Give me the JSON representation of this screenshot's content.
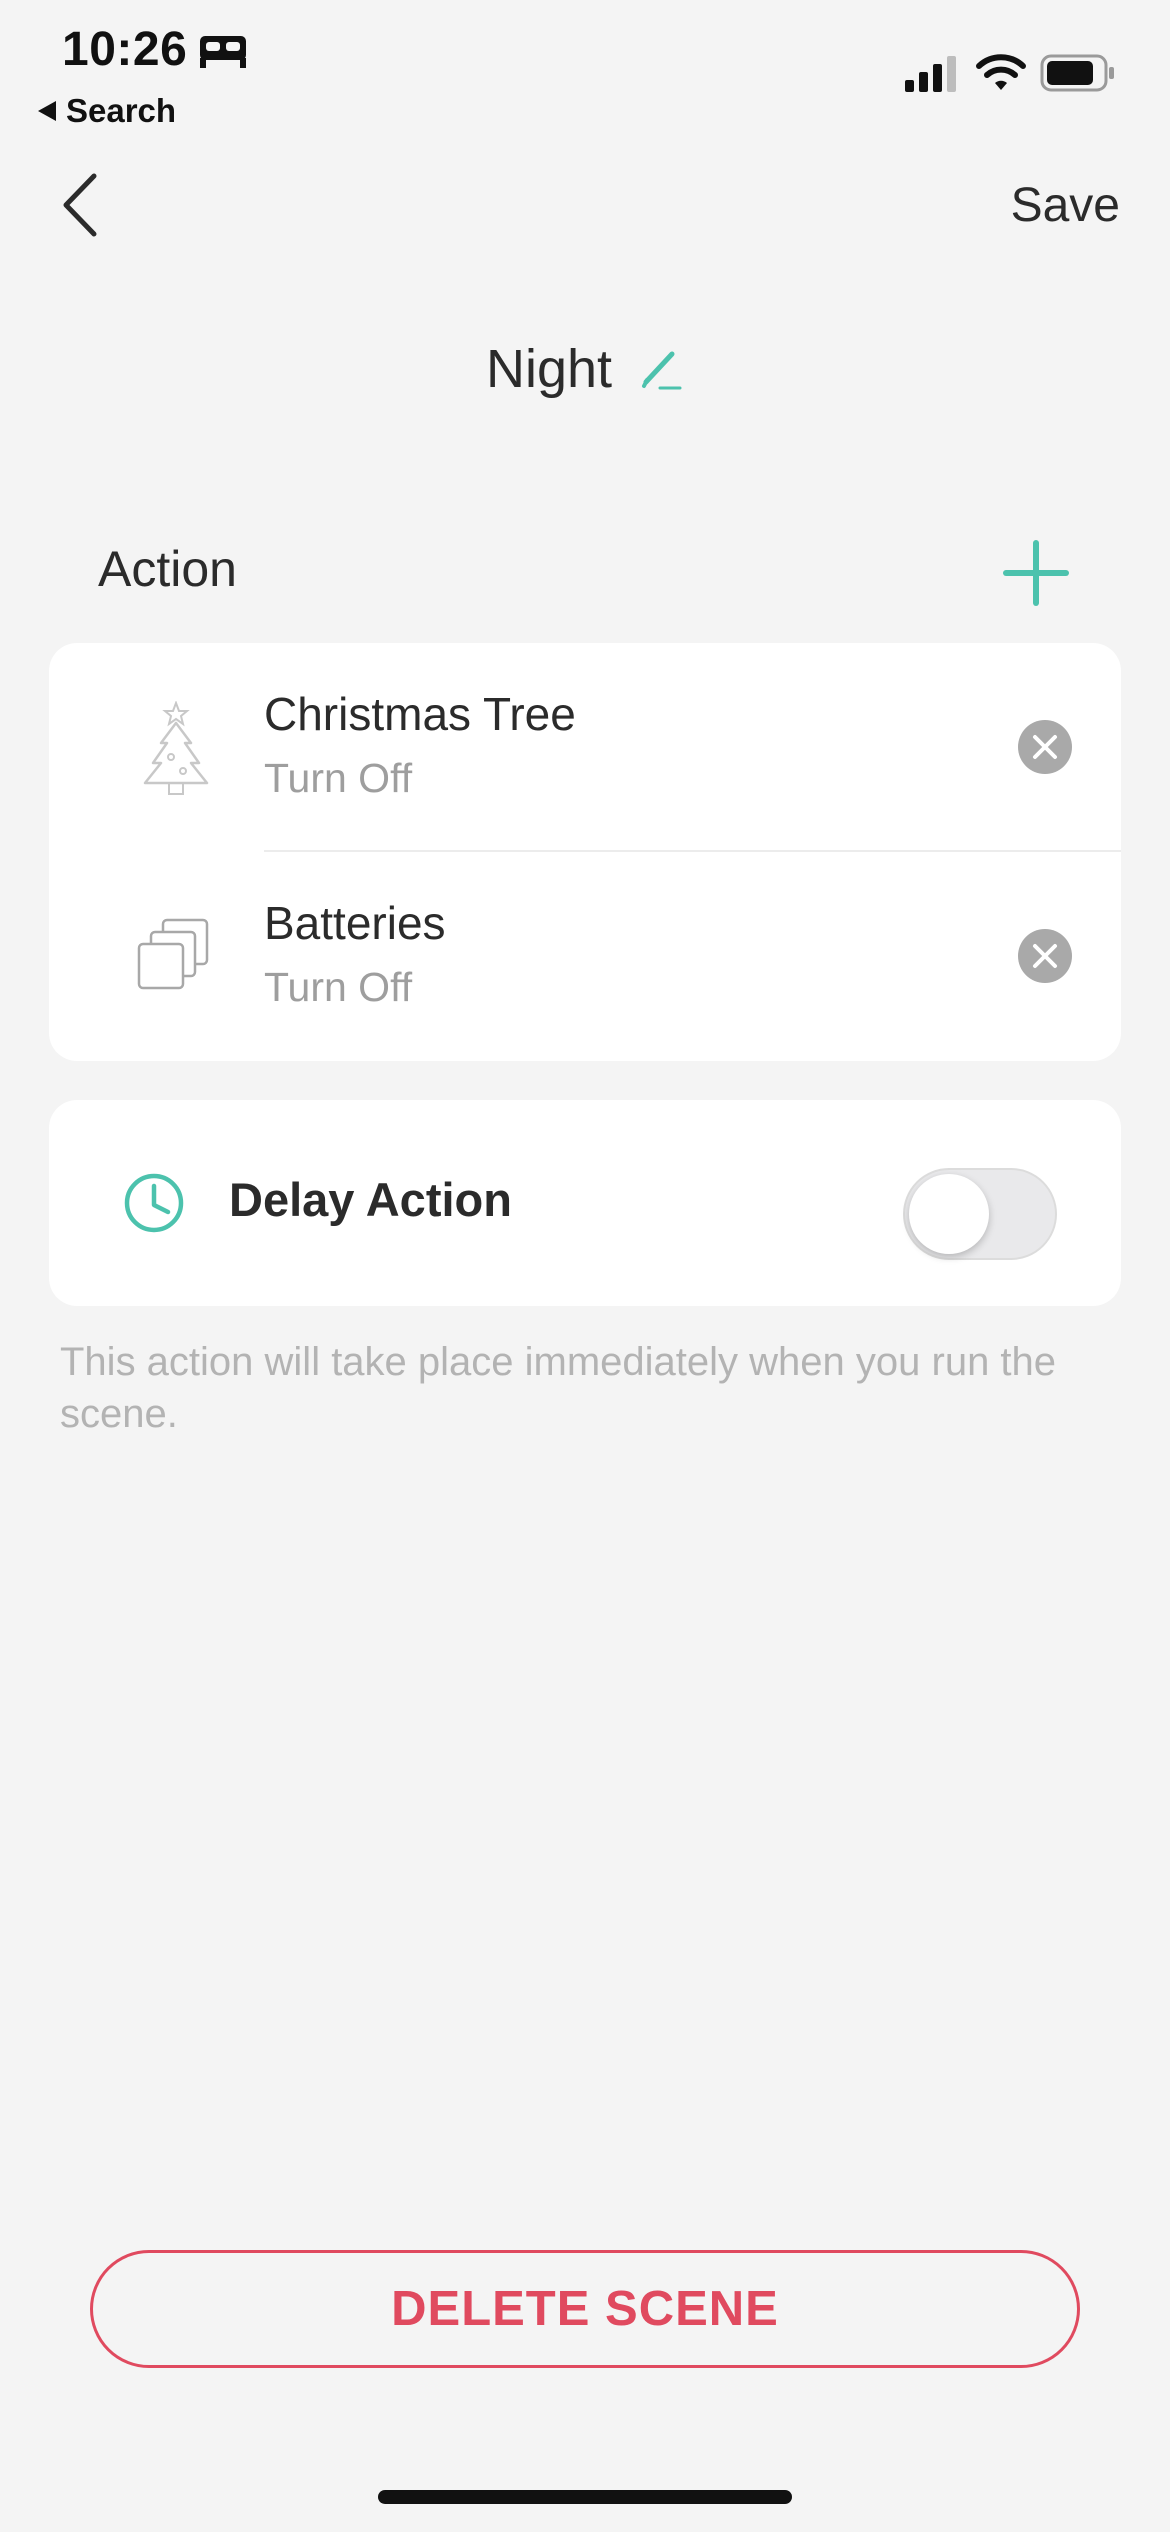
{
  "status_bar": {
    "time": "10:26",
    "back_app": "Search",
    "icons": [
      "bed-icon",
      "signal-icon",
      "wifi-icon",
      "battery-icon"
    ]
  },
  "header": {
    "back_icon": "chevron-left-icon",
    "save_label": "Save",
    "title": "Night",
    "edit_icon": "pencil-icon"
  },
  "action_section": {
    "title": "Action",
    "add_icon": "plus-icon",
    "items": [
      {
        "name": "Christmas Tree",
        "state": "Turn Off",
        "icon": "christmas-tree-icon"
      },
      {
        "name": "Batteries",
        "state": "Turn Off",
        "icon": "stacked-squares-icon"
      }
    ]
  },
  "delay": {
    "label": "Delay Action",
    "icon": "clock-icon",
    "enabled": false,
    "helper_text": "This action will take place immediately when you run the scene."
  },
  "delete_label": "DELETE SCENE",
  "colors": {
    "accent": "#4cc2ad",
    "danger": "#e04a5f",
    "background": "#f4f4f4",
    "card": "#ffffff"
  }
}
